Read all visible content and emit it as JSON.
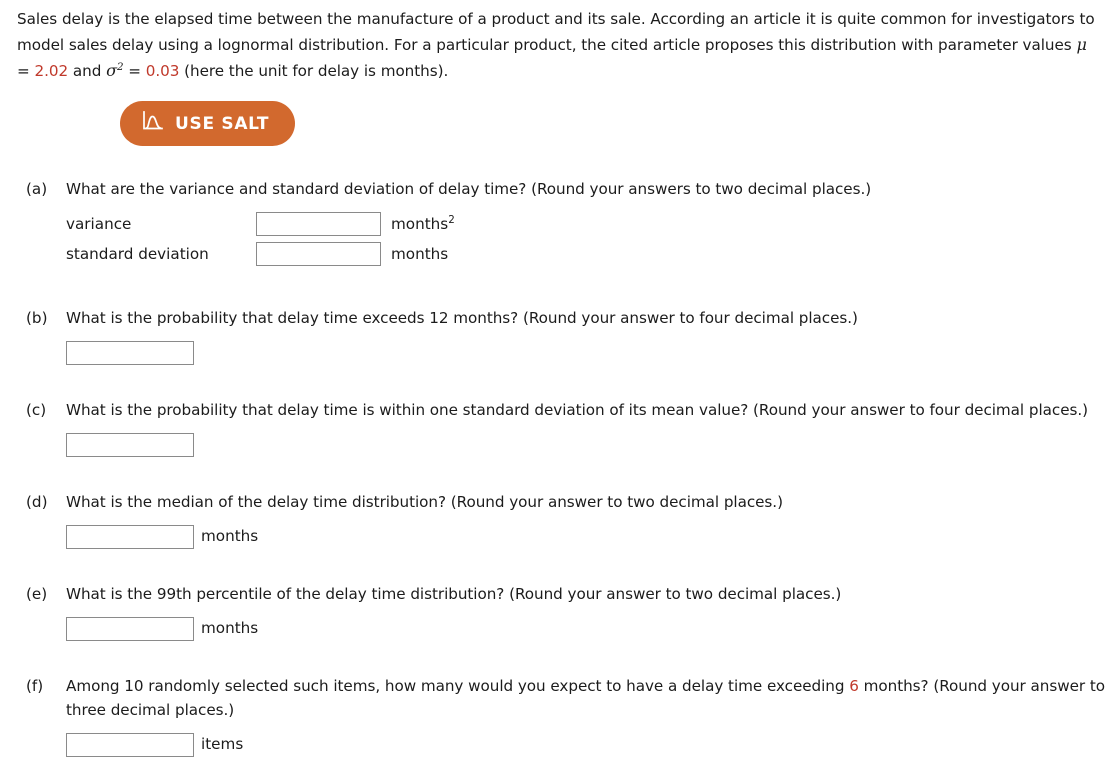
{
  "intro": {
    "text_part1": "Sales delay is the elapsed time between the manufacture of a product and its sale. According an article it is quite common for investigators to model sales delay using a lognormal distribution. For a particular product, the cited article proposes this distribution with parameter values ",
    "mu_symbol": "μ",
    "eq1": " = ",
    "mu_value": "2.02",
    "and_text": " and ",
    "sigma_symbol": "σ",
    "sigma_exponent": "2",
    "eq2": " = ",
    "sigma_value": "0.03",
    "text_part2": " (here the unit for delay is months)."
  },
  "salt_button": {
    "label": "USE SALT",
    "icon": "distribution-curve-icon",
    "color": "#d2692e"
  },
  "questions": [
    {
      "label": "(a)",
      "text": "What are the variance and standard deviation of delay time? (Round your answers to two decimal places.)",
      "answers": [
        {
          "label": "variance",
          "value": "",
          "unit": "months",
          "unit_sup": "2"
        },
        {
          "label": "standard deviation",
          "value": "",
          "unit": "months",
          "unit_sup": ""
        }
      ]
    },
    {
      "label": "(b)",
      "text": "What is the probability that delay time exceeds 12 months? (Round your answer to four decimal places.)",
      "answers": [
        {
          "label": "",
          "value": "",
          "unit": "",
          "unit_sup": ""
        }
      ]
    },
    {
      "label": "(c)",
      "text": "What is the probability that delay time is within one standard deviation of its mean value? (Round your answer to four decimal places.)",
      "answers": [
        {
          "label": "",
          "value": "",
          "unit": "",
          "unit_sup": ""
        }
      ]
    },
    {
      "label": "(d)",
      "text": "What is the median of the delay time distribution? (Round your answer to two decimal places.)",
      "answers": [
        {
          "label": "",
          "value": "",
          "unit": "months",
          "unit_sup": ""
        }
      ]
    },
    {
      "label": "(e)",
      "text": "What is the 99th percentile of the delay time distribution? (Round your answer to two decimal places.)",
      "answers": [
        {
          "label": "",
          "value": "",
          "unit": "months",
          "unit_sup": ""
        }
      ]
    },
    {
      "label": "(f)",
      "text_before": "Among 10 randomly selected such items, how many would you expect to have a delay time exceeding ",
      "highlight": "6",
      "text_after": " months? (Round your answer to three decimal places.)",
      "answers": [
        {
          "label": "",
          "value": "",
          "unit": "items",
          "unit_sup": ""
        }
      ]
    }
  ]
}
